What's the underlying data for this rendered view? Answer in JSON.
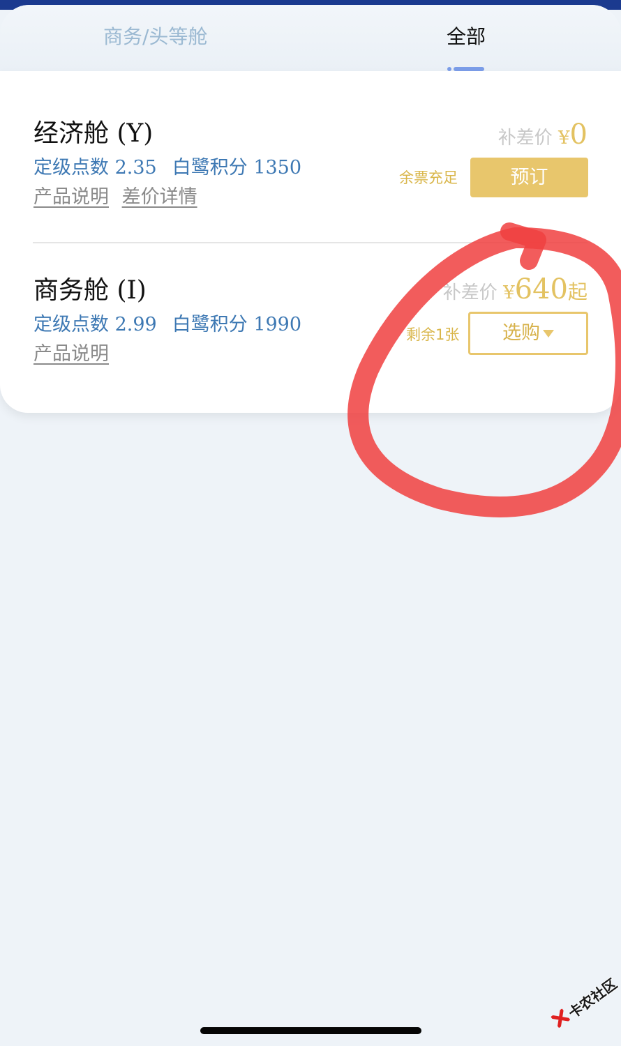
{
  "tabs": [
    {
      "label": "商务/头等舱",
      "active": false
    },
    {
      "label": "全部",
      "active": true
    }
  ],
  "cabins": [
    {
      "name": "经济舱",
      "code": "(Y)",
      "grade_label": "定级点数",
      "grade_value": "2.35",
      "points_label": "白鹭积分",
      "points_value": "1350",
      "links": [
        "产品说明",
        "差价详情"
      ],
      "price_prefix": "补差价",
      "price_symbol": "¥",
      "price_value": "0",
      "price_suffix": "",
      "stock": "余票充足",
      "button": "预订"
    },
    {
      "name": "商务舱",
      "code": "(I)",
      "grade_label": "定级点数",
      "grade_value": "2.99",
      "points_label": "白鹭积分",
      "points_value": "1990",
      "links": [
        "产品说明"
      ],
      "price_prefix": "补差价",
      "price_symbol": "¥",
      "price_value": "640",
      "price_suffix": "起",
      "stock": "剩余1张",
      "button": "选购"
    }
  ],
  "watermark": "卡农社区",
  "colors": {
    "accent_gold": "#e8c66c",
    "info_blue": "#3d78b3",
    "tab_indicator": "#7b9de8",
    "annotation_red": "#f0403f",
    "top_bar": "#1b3a8f"
  }
}
